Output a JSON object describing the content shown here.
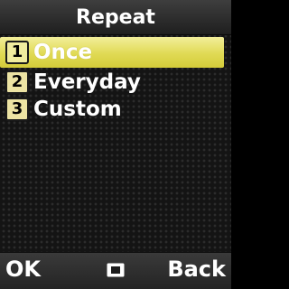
{
  "header": {
    "title": "Repeat"
  },
  "menu": {
    "items": [
      {
        "number": "1",
        "label": "Once",
        "selected": true
      },
      {
        "number": "2",
        "label": "Everyday",
        "selected": false
      },
      {
        "number": "3",
        "label": "Custom",
        "selected": false
      }
    ]
  },
  "softkeys": {
    "left_label": "OK",
    "center_icon": "menu-square-icon",
    "right_label": "Back"
  },
  "colors": {
    "selection": "#e0da54",
    "badge": "#ece3a3",
    "background": "#141414",
    "text": "#ffffff"
  }
}
